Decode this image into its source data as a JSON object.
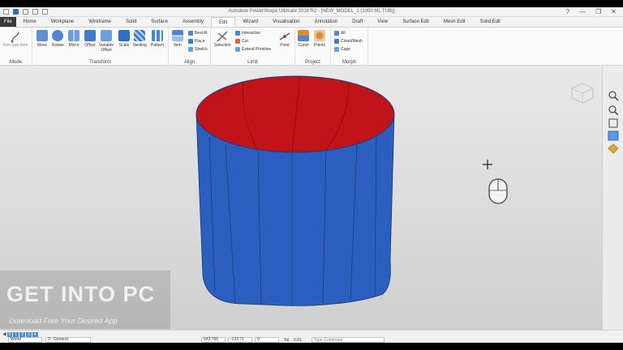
{
  "quick_access": {
    "icons": [
      "file-new-icon",
      "save-icon",
      "undo-icon",
      "redo-icon",
      "pointer-icon"
    ]
  },
  "window": {
    "title": "Autodesk PowerShape Ultimate 2018 R2 - [NEW_MODEL_1 (1000 ML TUB)]",
    "controls": {
      "help": "?",
      "minimize": "—",
      "restore": "❐",
      "close": "✕"
    }
  },
  "tabs": [
    "File",
    "Home",
    "Workplane",
    "Wireframe",
    "Solid",
    "Surface",
    "Assembly",
    "Edit",
    "Wizard",
    "Visualisation",
    "Annotation",
    "Draft",
    "View",
    "Surface Edit",
    "Mesh Edit",
    "Solid Edit"
  ],
  "active_tab": "Edit",
  "ribbon": {
    "mode": {
      "label": "Mode",
      "button": "Pen Sub-item"
    },
    "transform": {
      "label": "Transform",
      "buttons": [
        "Move",
        "Rotate",
        "Mirror",
        "Offset",
        "Variable\nOffset",
        "Scale",
        "Nesting",
        "Pattern"
      ]
    },
    "align": {
      "label": "Align",
      "buttons": [
        "Item"
      ],
      "small": [
        "Best-fit",
        "Place",
        "Stretch"
      ]
    },
    "limit": {
      "label": "Limit",
      "buttons": [
        "Selection",
        "Point"
      ],
      "small": [
        "Interactive",
        "Cut",
        "Extend Primitive"
      ]
    },
    "project": {
      "label": "Project",
      "buttons": [
        "Curve",
        "Points"
      ]
    },
    "morph": {
      "label": "Morph",
      "small": [
        "All",
        "Cloud/Mesh",
        "Cage"
      ]
    }
  },
  "colors": {
    "tub_outside": "#2a5fc0",
    "tub_inside": "#c0141a",
    "accent": "#2d6fc2"
  },
  "watermark": {
    "main": "GET INTO PC",
    "sub": "Download Free Your Desired App"
  },
  "statusbar": {
    "layer_tabs": [
      "0",
      "1",
      "2",
      "3",
      "4"
    ],
    "workplane": "World",
    "level": "0 : General",
    "x": "643.766",
    "y": "-133.71",
    "z": "0",
    "tol_label": "Tol",
    "tol_value": "0.01",
    "command_placeholder": "Type Command"
  },
  "sidebar_icons": [
    "zoom-icon",
    "zoom-box-icon",
    "view-box-icon",
    "shaded-icon",
    "render-icon"
  ],
  "viewport_cursor": {
    "icons": [
      "crosshair-icon",
      "mouse-icon"
    ]
  }
}
